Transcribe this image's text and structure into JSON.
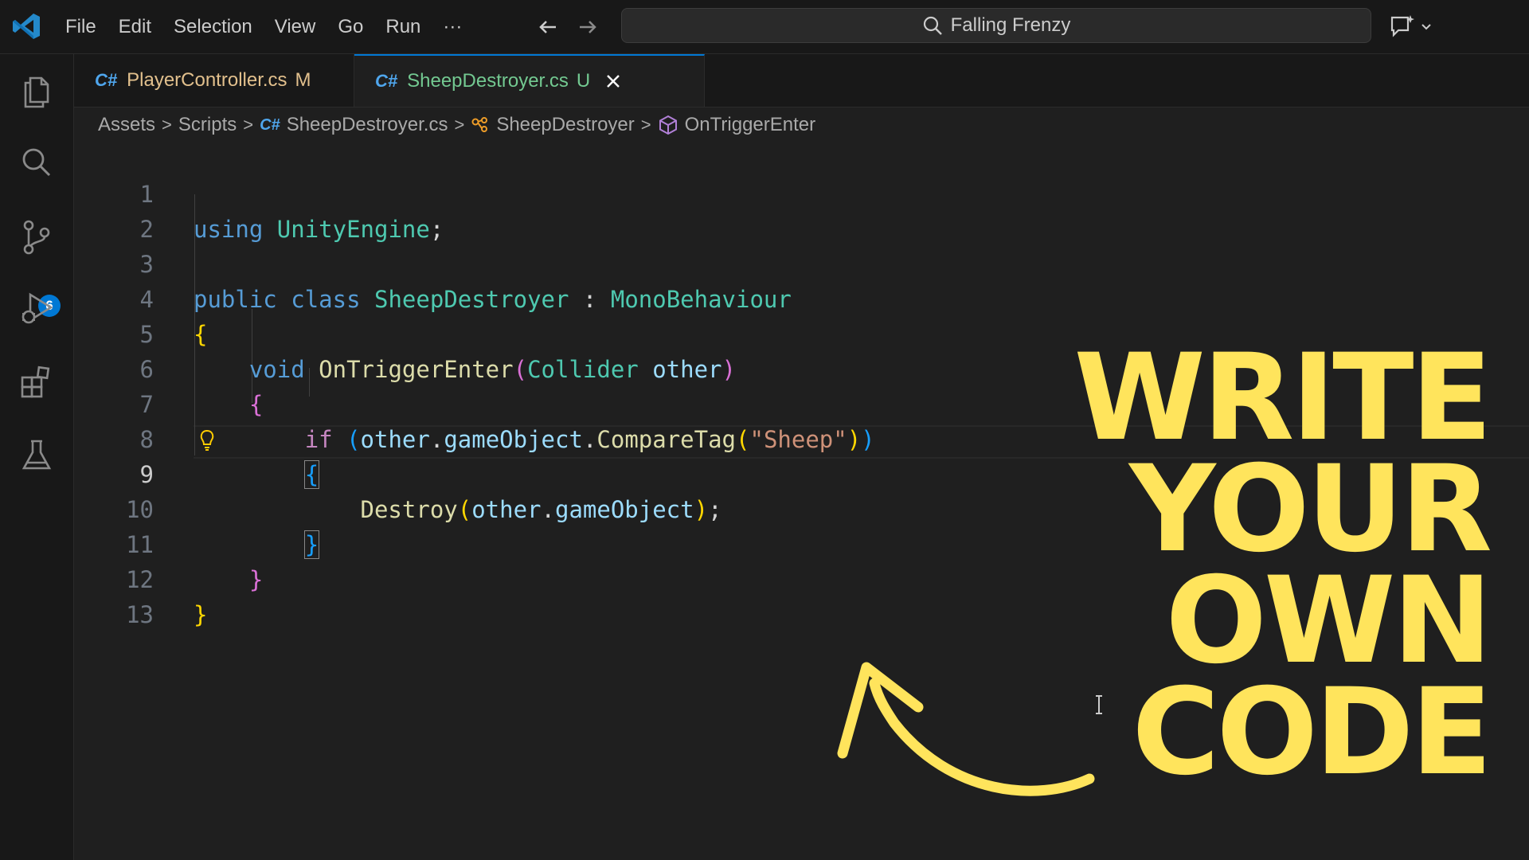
{
  "menu": [
    "File",
    "Edit",
    "Selection",
    "View",
    "Go",
    "Run",
    "···"
  ],
  "command_center": {
    "text": "Falling Frenzy",
    "icon": "search-icon"
  },
  "activity_bar": {
    "items": [
      "explorer-icon",
      "search-icon",
      "source-control-icon",
      "run-debug-icon",
      "extensions-icon",
      "testing-icon"
    ],
    "source_control_badge": "6"
  },
  "tabs": [
    {
      "icon": "C#",
      "label": "PlayerController.cs",
      "flag": "M",
      "active": false
    },
    {
      "icon": "C#",
      "label": "SheepDestroyer.cs",
      "flag": "U",
      "active": true
    }
  ],
  "breadcrumb": {
    "items": [
      "Assets",
      "Scripts",
      "SheepDestroyer.cs",
      "SheepDestroyer",
      "OnTriggerEnter"
    ],
    "separator": ">"
  },
  "editor": {
    "active_line": "9",
    "line_numbers": [
      "1",
      "2",
      "3",
      "4",
      "5",
      "6",
      "7",
      "8",
      "9",
      "10",
      "11",
      "12",
      "13"
    ]
  },
  "code": {
    "l1": [
      "using",
      "UnityEngine",
      ";"
    ],
    "l3": [
      "public",
      "class",
      "SheepDestroyer",
      ":",
      "MonoBehaviour"
    ],
    "l4": [
      "{"
    ],
    "l5": [
      "void",
      "OnTriggerEnter",
      "(",
      "Collider",
      "other",
      ")"
    ],
    "l6": [
      "{"
    ],
    "l7": [
      "if",
      "(",
      "other",
      ".",
      "gameObject",
      ".",
      "CompareTag",
      "(",
      "\"Sheep\"",
      ")",
      ")"
    ],
    "l8": [
      "{"
    ],
    "l9": [
      "Destroy",
      "(",
      "other",
      ".",
      "gameObject",
      ")",
      ";"
    ],
    "l10": [
      "}"
    ],
    "l11": [
      "}"
    ],
    "l12": [
      "}"
    ]
  },
  "overlay": {
    "words": [
      "WRITE",
      "YOUR",
      "OWN",
      "CODE"
    ],
    "color": "#ffe45c"
  },
  "colors": {
    "accent": "#0078d4",
    "modified": "#e2c08d",
    "untracked": "#73c991"
  }
}
